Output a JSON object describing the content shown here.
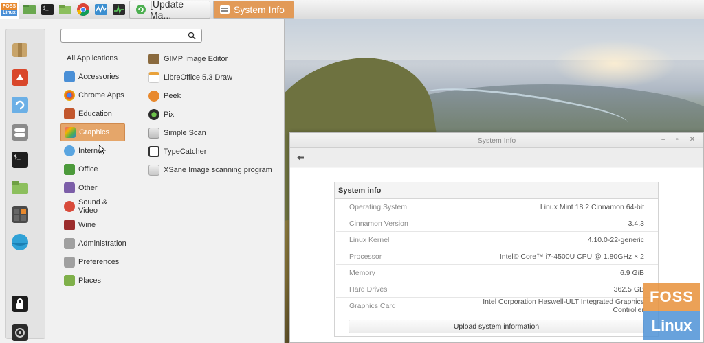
{
  "taskbar": {
    "menu_logo_top": "FOSS",
    "menu_logo_bottom": "Linux",
    "launchers": [
      "folder-green-icon",
      "terminal-icon",
      "folder-icon",
      "chrome-icon",
      "system-monitor-icon",
      "activity-monitor-icon"
    ],
    "tasks": [
      {
        "label": "[Update Ma...",
        "icon": "update-manager-icon",
        "active": false
      },
      {
        "label": "System Info",
        "icon": "system-info-icon",
        "active": true
      }
    ]
  },
  "menu": {
    "search_value": "",
    "favorites": [
      "archive-manager-icon",
      "firefox-icon",
      "update-icon",
      "settings-toggle-icon",
      "terminal-icon",
      "folder-icon",
      "calculator-icon",
      "browser-icon",
      "lock-screen-icon",
      "logout-icon"
    ],
    "categories": [
      {
        "label": "All Applications",
        "color": "",
        "highlighted": false
      },
      {
        "label": "Accessories",
        "color": "#4a8fd6",
        "highlighted": false
      },
      {
        "label": "Chrome Apps",
        "color": "#dd4b39",
        "highlighted": false
      },
      {
        "label": "Education",
        "color": "#c2572d",
        "highlighted": false
      },
      {
        "label": "Graphics",
        "color": "#b44fa8",
        "highlighted": true
      },
      {
        "label": "Internet",
        "color": "#5aa5e0",
        "highlighted": false
      },
      {
        "label": "Office",
        "color": "#4c9a3b",
        "highlighted": false
      },
      {
        "label": "Other",
        "color": "#7c5ea8",
        "highlighted": false
      },
      {
        "label": "Sound & Video",
        "color": "#d84a3a",
        "highlighted": false
      },
      {
        "label": "Wine",
        "color": "#9b2c2c",
        "highlighted": false
      },
      {
        "label": "Administration",
        "color": "#8b8b8b",
        "highlighted": false
      },
      {
        "label": "Preferences",
        "color": "#8b8b8b",
        "highlighted": false
      },
      {
        "label": "Places",
        "color": "#7fb04a",
        "highlighted": false
      }
    ],
    "apps": [
      {
        "label": "GIMP Image Editor",
        "color": "#8a6a3e"
      },
      {
        "label": "LibreOffice 5.3 Draw",
        "color": "#e9a23b"
      },
      {
        "label": "Peek",
        "color": "#e8892e"
      },
      {
        "label": "Pix",
        "color": "#2b2b2b"
      },
      {
        "label": "Simple Scan",
        "color": "#cfcfcf"
      },
      {
        "label": "TypeCatcher",
        "color": "#333333"
      },
      {
        "label": "XSane Image scanning program",
        "color": "#d8d8d8"
      }
    ]
  },
  "window": {
    "title": "System Info",
    "section_title": "System info",
    "rows": [
      {
        "key": "Operating System",
        "value": "Linux Mint 18.2 Cinnamon 64-bit"
      },
      {
        "key": "Cinnamon Version",
        "value": "3.4.3"
      },
      {
        "key": "Linux Kernel",
        "value": "4.10.0-22-generic"
      },
      {
        "key": "Processor",
        "value": "Intel© Core™ i7-4500U CPU @ 1.80GHz × 2"
      },
      {
        "key": "Memory",
        "value": "6.9 GiB"
      },
      {
        "key": "Hard Drives",
        "value": "362.5 GB"
      },
      {
        "key": "Graphics Card",
        "value": "Intel Corporation Haswell-ULT Integrated Graphics Controller"
      }
    ],
    "upload_label": "Upload system information",
    "controls": {
      "minimize": "–",
      "maximize": "▫",
      "close": "✕"
    }
  },
  "watermark": {
    "top": "FOSS",
    "bottom": "Linux"
  },
  "colors": {
    "accent": "#e29a57",
    "highlight": "#e5a66a"
  }
}
